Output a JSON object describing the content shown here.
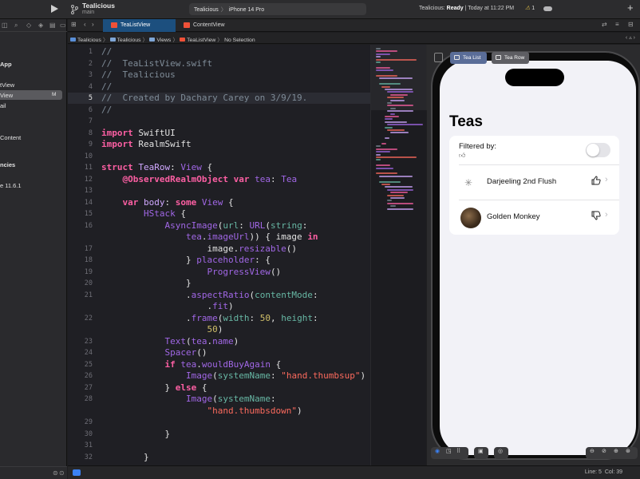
{
  "titlebar": {
    "project": "Tealicious",
    "branch": "main",
    "scheme_target": "Tealicious",
    "scheme_device": "iPhone 14 Pro",
    "status_app": "Tealicious:",
    "status_state": "Ready",
    "status_time": "| Today at 11:22 PM",
    "warning_count": "1"
  },
  "navigator": {
    "items": [
      {
        "label": "App"
      },
      {
        "label": "tView"
      },
      {
        "label": "View",
        "badge": "M"
      },
      {
        "label": "ail"
      },
      {
        "label": "Content"
      },
      {
        "label": "ncies"
      },
      {
        "label": "e 11.6.1"
      }
    ]
  },
  "tabs": [
    {
      "label": "TeaListView"
    },
    {
      "label": "ContentView"
    }
  ],
  "breadcrumb": [
    "Tealicious",
    "Tealicious",
    "Views",
    "TeaListView",
    "No Selection"
  ],
  "code_lines": [
    {
      "n": "1",
      "text": "//"
    },
    {
      "n": "2",
      "text": "//  TeaListView.swift"
    },
    {
      "n": "3",
      "text": "//  Tealicious"
    },
    {
      "n": "4",
      "text": "//"
    },
    {
      "n": "5",
      "text": "//  Created by Dachary Carey on 3/9/19."
    },
    {
      "n": "6",
      "text": "//"
    },
    {
      "n": "7",
      "text": ""
    },
    {
      "n": "8",
      "text": "import SwiftUI"
    },
    {
      "n": "9",
      "text": "import RealmSwift"
    },
    {
      "n": "10",
      "text": ""
    },
    {
      "n": "11",
      "text": "struct TeaRow: View {"
    },
    {
      "n": "12",
      "text": "    @ObservedRealmObject var tea: Tea"
    },
    {
      "n": "13",
      "text": ""
    },
    {
      "n": "14",
      "text": "    var body: some View {"
    },
    {
      "n": "15",
      "text": "        HStack {"
    },
    {
      "n": "16",
      "text": "            AsyncImage(url: URL(string:"
    },
    {
      "n": "",
      "text": "                tea.imageUrl)) { image in"
    },
    {
      "n": "17",
      "text": "                    image.resizable()"
    },
    {
      "n": "18",
      "text": "                } placeholder: {"
    },
    {
      "n": "19",
      "text": "                    ProgressView()"
    },
    {
      "n": "20",
      "text": "                }"
    },
    {
      "n": "21",
      "text": "                .aspectRatio(contentMode:"
    },
    {
      "n": "",
      "text": "                    .fit)"
    },
    {
      "n": "22",
      "text": "                .frame(width: 50, height:"
    },
    {
      "n": "",
      "text": "                    50)"
    },
    {
      "n": "23",
      "text": "            Text(tea.name)"
    },
    {
      "n": "24",
      "text": "            Spacer()"
    },
    {
      "n": "25",
      "text": "            if tea.wouldBuyAgain {"
    },
    {
      "n": "26",
      "text": "                Image(systemName: \"hand.thumbsup\")"
    },
    {
      "n": "27",
      "text": "            } else {"
    },
    {
      "n": "28",
      "text": "                Image(systemName:"
    },
    {
      "n": "",
      "text": "                    \"hand.thumbsdown\")"
    },
    {
      "n": "29",
      "text": ""
    },
    {
      "n": "30",
      "text": "            }"
    },
    {
      "n": "31",
      "text": ""
    },
    {
      "n": "32",
      "text": "        }"
    }
  ],
  "canvas": {
    "chips": [
      {
        "label": "Tea List"
      },
      {
        "label": "Tea Row"
      }
    ]
  },
  "preview": {
    "title": "Teas",
    "filter_label": "Filtered by:",
    "filter_icon": "thumbsup-icon",
    "rows": [
      {
        "name": "Darjeeling 2nd Flush",
        "icon": "thumbsup-icon",
        "leading": "progress-spinner"
      },
      {
        "name": "Golden Monkey",
        "icon": "thumbsdown-icon",
        "leading": "tea-image"
      }
    ]
  },
  "statusbar": {
    "line": "Line: 5",
    "col": "Col: 39"
  },
  "colors": {
    "accent": "#3b82f6",
    "tab_active": "#1c4f7e",
    "editor_bg": "#1f1f24",
    "keyword": "#fc5fa3",
    "string": "#fc6a5d",
    "comment": "#7f8c98"
  }
}
